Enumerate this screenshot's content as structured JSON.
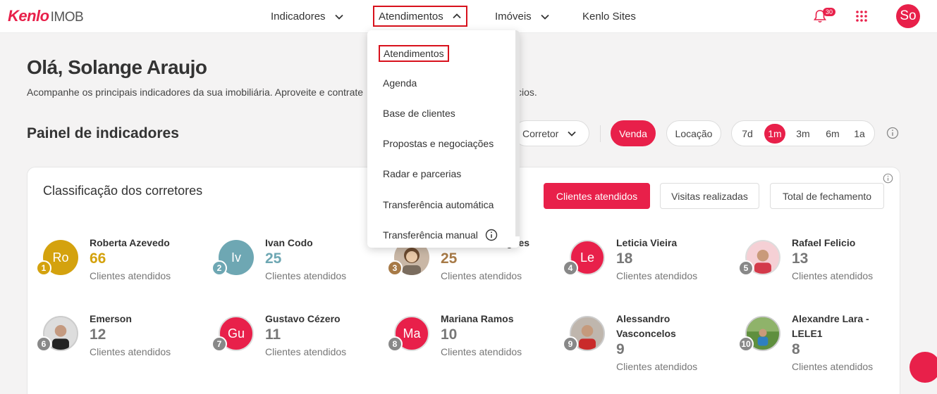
{
  "header": {
    "logo_brand": "Kenlo",
    "logo_product": "IMOB",
    "nav": [
      {
        "label": "Indicadores"
      },
      {
        "label": "Atendimentos"
      },
      {
        "label": "Imóveis"
      },
      {
        "label": "Kenlo Sites"
      }
    ],
    "notification_count": "30",
    "user_initials": "So"
  },
  "dropdown": {
    "items": [
      {
        "label": "Atendimentos"
      },
      {
        "label": "Agenda"
      },
      {
        "label": "Base de clientes"
      },
      {
        "label": "Propostas e negociações"
      },
      {
        "label": "Radar e parcerias"
      },
      {
        "label": "Transferência automática"
      },
      {
        "label": "Transferência manual"
      }
    ]
  },
  "greeting": {
    "title": "Olá, Solange Araujo",
    "subtitle": "Acompanhe os principais indicadores da sua imobiliária. Aproveite e contrate",
    "subtitle_tail": "cios."
  },
  "panel": {
    "title": "Painel de indicadores",
    "corretor_label": "Corretor",
    "venda_label": "Venda",
    "locacao_label": "Locação",
    "periods": [
      "7d",
      "1m",
      "3m",
      "6m",
      "1a"
    ],
    "active_period": "1m"
  },
  "ranking_card": {
    "title": "Classificação dos corretores",
    "tabs": [
      "Clientes atendidos",
      "Visitas realizadas",
      "Total de fechamento"
    ],
    "metric_label": "Clientes atendidos",
    "brokers": [
      {
        "rank": "1",
        "initials": "Ro",
        "name": "Roberta Azevedo",
        "value": "66",
        "color": "#d4a20e"
      },
      {
        "rank": "2",
        "initials": "Iv",
        "name": "Ivan Codo",
        "value": "25",
        "color": "#6ea7b3"
      },
      {
        "rank": "3",
        "initials": "",
        "name": "Mariana Rodrigues",
        "value": "25",
        "color": "#a77a47"
      },
      {
        "rank": "4",
        "initials": "Le",
        "name": "Leticia Vieira",
        "value": "18",
        "color": "#e8204a"
      },
      {
        "rank": "5",
        "initials": "",
        "name": "Rafael Felicio",
        "value": "13",
        "color": "#888888"
      },
      {
        "rank": "6",
        "initials": "",
        "name": "Emerson",
        "value": "12",
        "color": "#888888"
      },
      {
        "rank": "7",
        "initials": "Gu",
        "name": "Gustavo Cézero",
        "value": "11",
        "color": "#e8204a"
      },
      {
        "rank": "8",
        "initials": "Ma",
        "name": "Mariana Ramos",
        "value": "10",
        "color": "#e8204a"
      },
      {
        "rank": "9",
        "initials": "",
        "name": "Alessandro Vasconcelos",
        "value": "9",
        "color": "#888888"
      },
      {
        "rank": "10",
        "initials": "",
        "name": "Alexandre Lara - LELE1",
        "value": "8",
        "color": "#888888"
      }
    ]
  },
  "colors": {
    "accent": "#e8204a",
    "highlight_border": "#d8111c",
    "gold": "#d4a20e",
    "silver": "#6ea7b3",
    "bronze": "#a77a47"
  }
}
